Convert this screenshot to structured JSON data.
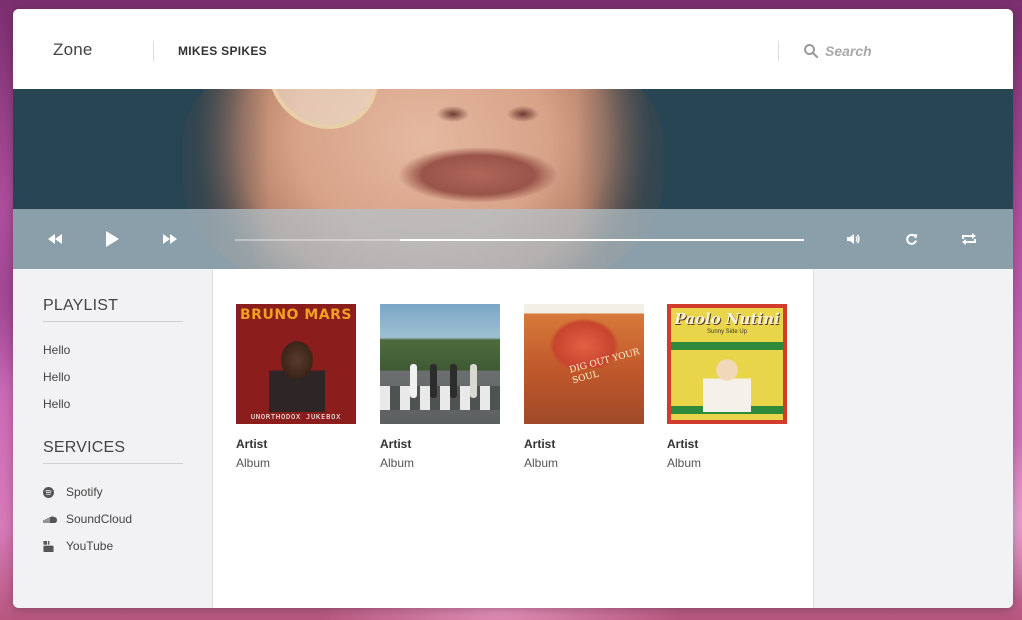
{
  "header": {
    "brand": "Zone",
    "user": "MIKES SPIKES",
    "search": {
      "placeholder": "Search",
      "value": ""
    }
  },
  "player": {
    "progress": 0.29,
    "buttons": [
      "rewind-icon",
      "play-icon",
      "fast-forward-icon",
      "volume-icon",
      "refresh-icon",
      "repeat-icon"
    ]
  },
  "sidebar": {
    "playlist_title": "PLAYLIST",
    "playlist": [
      {
        "label": "Hello"
      },
      {
        "label": "Hello"
      },
      {
        "label": "Hello"
      }
    ],
    "services_title": "SERVICES",
    "services": [
      {
        "label": "Spotify",
        "icon": "spotify-icon"
      },
      {
        "label": "SoundCloud",
        "icon": "soundcloud-icon"
      },
      {
        "label": "YouTube",
        "icon": "youtube-icon"
      }
    ]
  },
  "albums": [
    {
      "artist": "Artist",
      "album": "Album",
      "cover_title": "BRUNO MARS",
      "cover_subtitle": "UNORTHODOX JUKEBOX"
    },
    {
      "artist": "Artist",
      "album": "Album"
    },
    {
      "artist": "Artist",
      "album": "Album",
      "cover_text": "DIG OUT YOUR SOUL"
    },
    {
      "artist": "Artist",
      "album": "Album",
      "cover_title": "Paolo Nutini",
      "cover_subtitle": "Sunny Side Up"
    }
  ],
  "colors": {
    "hero": "#274553",
    "controls": "#b2c2ca",
    "sidebar": "#f2f2f4"
  }
}
